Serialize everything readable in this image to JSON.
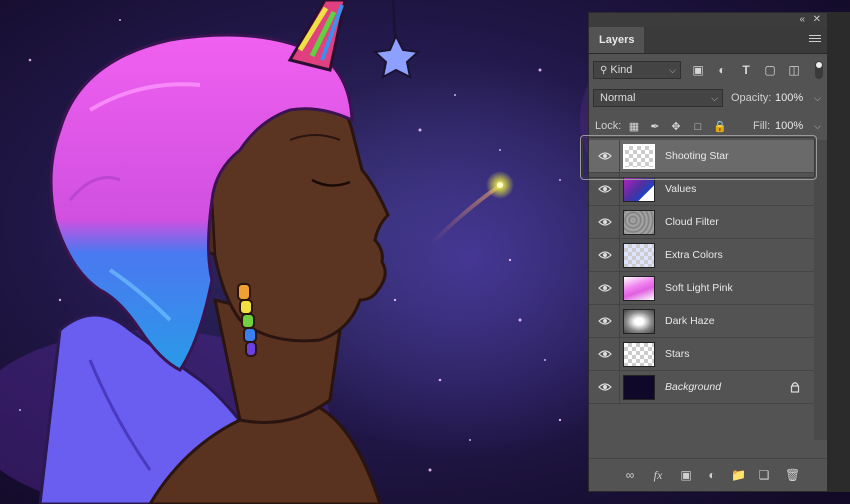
{
  "panel": {
    "tab_label": "Layers",
    "filter_kind": "Kind",
    "blend_mode": "Normal",
    "opacity_label": "Opacity:",
    "opacity_value": "100%",
    "lock_label": "Lock:",
    "fill_label": "Fill:",
    "fill_value": "100%"
  },
  "layers": [
    {
      "name": "Shooting Star",
      "selected": true,
      "thumb": "transparent"
    },
    {
      "name": "Values",
      "selected": false,
      "thumb": "values"
    },
    {
      "name": "Cloud Filter",
      "selected": false,
      "thumb": "cloud"
    },
    {
      "name": "Extra Colors",
      "selected": false,
      "thumb": "extra"
    },
    {
      "name": "Soft Light Pink",
      "selected": false,
      "thumb": "pink"
    },
    {
      "name": "Dark Haze",
      "selected": false,
      "thumb": "haze"
    },
    {
      "name": "Stars",
      "selected": false,
      "thumb": "transparent"
    },
    {
      "name": "Background",
      "selected": false,
      "thumb": "dark",
      "italic": true,
      "locked": true
    }
  ],
  "colors": {
    "panel_bg": "#535353",
    "selected_row": "#6a6a6a",
    "hair_pink": "#e85ef0",
    "hair_blue": "#3a8ef0",
    "skin": "#5a3220",
    "bow": "#6a5ef0",
    "star": "#8ea0ff",
    "space": "#1c1640"
  },
  "icons": {
    "visibility": "eye-icon",
    "filter_search": "search-icon",
    "lock_background": "lock-icon"
  }
}
